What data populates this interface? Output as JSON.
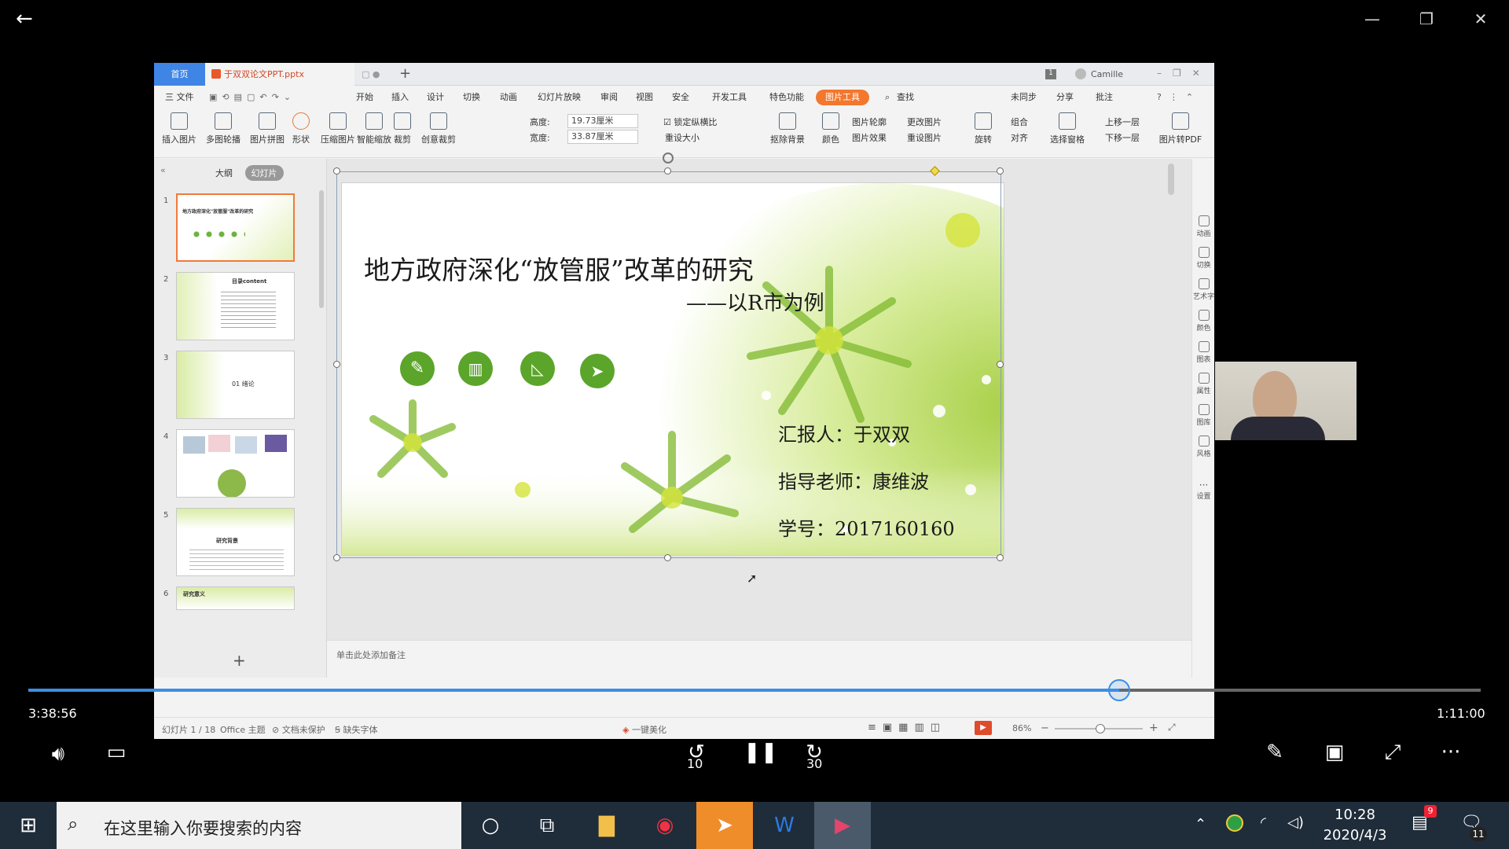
{
  "player": {
    "current_time": "3:38:56",
    "total_time": "1:11:00",
    "progress": 0.75,
    "skip_back": "10",
    "skip_forward": "30"
  },
  "wps": {
    "tabs": {
      "home": "首页",
      "doc": "于双双论文PPT.pptx"
    },
    "user": "Camille",
    "menu": [
      "三 文件",
      "开始",
      "插入",
      "设计",
      "切换",
      "动画",
      "幻灯片放映",
      "审阅",
      "视图",
      "安全",
      "开发工具",
      "特色功能"
    ],
    "menu_active": "图片工具",
    "search_label": "查找",
    "sync": "未同步",
    "share": "分享",
    "comment": "批注",
    "ribbon": [
      "插入图片",
      "多图轮播",
      "图片拼图",
      "形状",
      "压缩图片",
      "智能缩放",
      "裁剪",
      "创意裁剪"
    ],
    "height_label": "高度:",
    "height_value": "19.73厘米",
    "width_label": "宽度:",
    "width_value": "33.87厘米",
    "lock_ratio": "锁定纵横比",
    "reset_size": "重设大小",
    "ribbon2": [
      "抠除背景",
      "颜色"
    ],
    "small_btns": [
      "图片轮廓",
      "更改图片",
      "图片效果",
      "重设图片"
    ],
    "ribbon3": [
      "旋转",
      "对齐",
      "选择窗格"
    ],
    "group": "组合",
    "up_layer": "上移一层",
    "down_layer": "下移一层",
    "to_pdf": "图片转PDF",
    "panel_tabs": {
      "outline": "大纲",
      "slides": "幻灯片"
    },
    "thumbs": [
      {
        "num": "1",
        "title": "地方政府深化\"放管服\"改革的研究"
      },
      {
        "num": "2",
        "title": "目录content"
      },
      {
        "num": "3",
        "title": "01 绪论"
      },
      {
        "num": "4",
        "title": ""
      },
      {
        "num": "5",
        "title": "研究背景"
      },
      {
        "num": "6",
        "title": "研究意义"
      }
    ],
    "right_bar": [
      "动画",
      "切换",
      "艺术字",
      "颜色",
      "图表",
      "属性",
      "图库",
      "风格",
      "设置"
    ],
    "notes_placeholder": "单击此处添加备注",
    "status": {
      "slide_count": "幻灯片 1 / 18",
      "theme": "Office 主题",
      "protect": "文档未保护",
      "font": "缺失字体",
      "beautify": "一键美化",
      "zoom": "86%"
    }
  },
  "slide": {
    "title": "地方政府深化“放管服”改革的研究",
    "subtitle": "——以R市为例",
    "reporter": "汇报人：于双双",
    "advisor": "指导老师：康维波",
    "student_id": "学号：2017160160",
    "icons": [
      "pencil-icon",
      "book-icon",
      "ruler-icon",
      "cursor-icon"
    ]
  },
  "taskbar": {
    "search_placeholder": "在这里输入你要搜索的内容",
    "time": "10:28",
    "date": "2020/4/3",
    "notif_badge": "9",
    "action_badge": "11"
  }
}
